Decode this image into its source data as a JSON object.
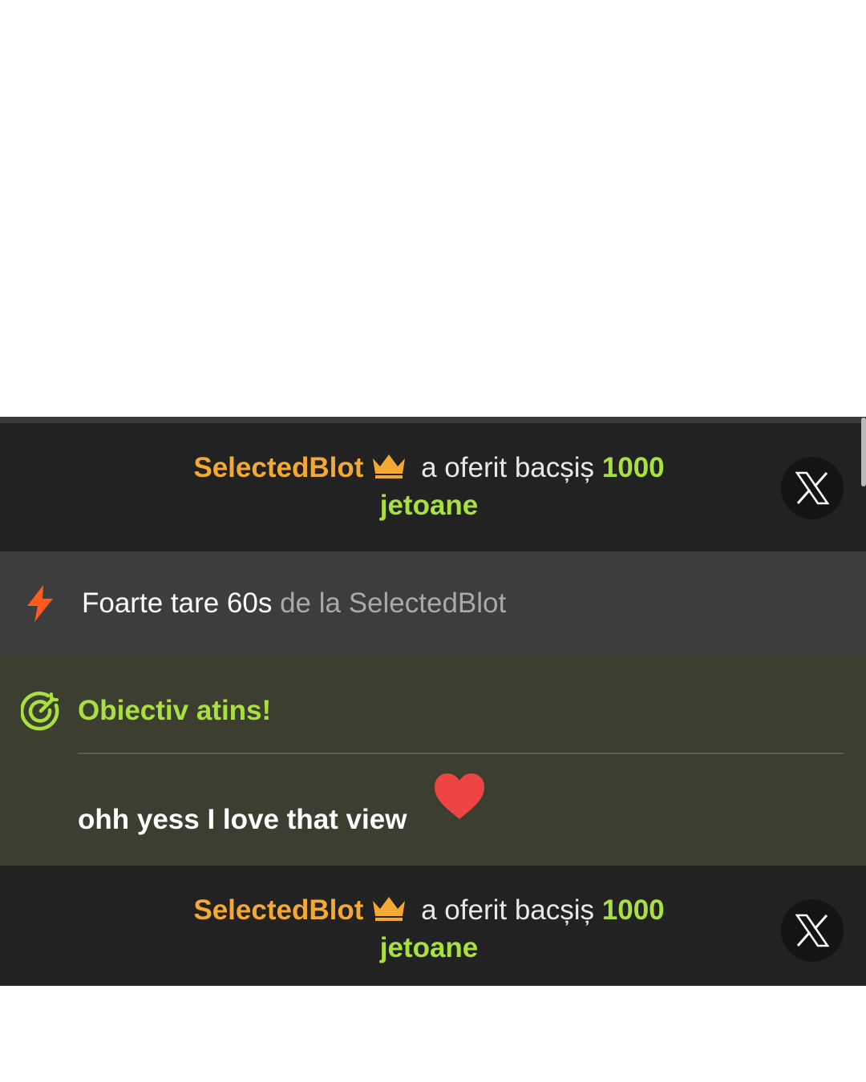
{
  "notifications": [
    {
      "type": "tip",
      "username": "SelectedBlot",
      "action": "a oferit bacșiș",
      "amount": "1000",
      "unit": "jetoane",
      "badge_icon": "crown-icon",
      "dismiss_icon": "x-logo-icon"
    },
    {
      "type": "boost",
      "icon": "lightning-bolt-icon",
      "label": "Foarte tare 60s",
      "source": "de la SelectedBlot"
    },
    {
      "type": "goal",
      "icon": "target-icon",
      "title": "Obiectiv atins!",
      "message": "ohh yess I love that view",
      "emoji": "heart-icon"
    },
    {
      "type": "tip",
      "username": "SelectedBlot",
      "action": "a oferit bacșiș",
      "amount": "1000",
      "unit": "jetoane",
      "badge_icon": "crown-icon",
      "dismiss_icon": "x-logo-icon"
    }
  ],
  "colors": {
    "username": "#f4a934",
    "amount": "#a8e040",
    "goal_title": "#a8e040",
    "bolt": "#ff5a1f",
    "heart": "#ee4444",
    "feed_bg": "#222222",
    "boost_bg": "#3d3d3d",
    "goal_bg": "#3c3f30"
  }
}
